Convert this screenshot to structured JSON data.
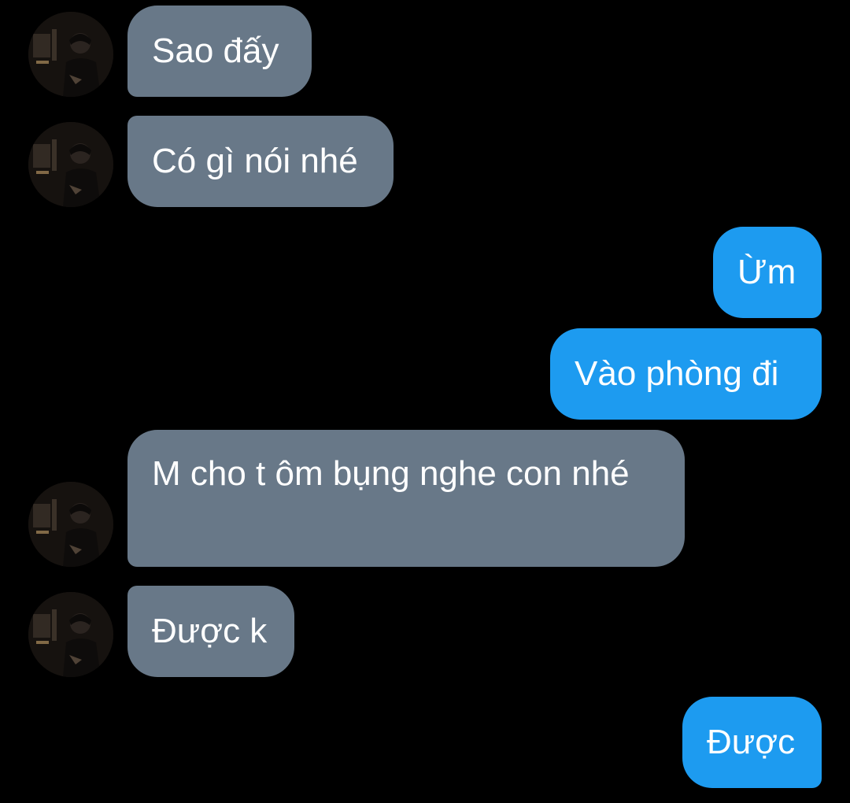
{
  "colors": {
    "background": "#000000",
    "incoming_bubble": "#687888",
    "outgoing_bubble": "#1d9bf0",
    "text": "#ffffff"
  },
  "messages": [
    {
      "direction": "incoming",
      "text": "Sao đấy",
      "avatar": "avatar-photo"
    },
    {
      "direction": "incoming",
      "text": "Có gì nói nhé",
      "avatar": "avatar-photo"
    },
    {
      "direction": "outgoing",
      "text": "Ừm"
    },
    {
      "direction": "outgoing",
      "text": "Vào phòng đi"
    },
    {
      "direction": "incoming",
      "text": "M cho t ôm bụng nghe con nhé",
      "avatar": "avatar-photo"
    },
    {
      "direction": "incoming",
      "text": "Được k",
      "avatar": "avatar-photo"
    },
    {
      "direction": "outgoing",
      "text": "Được"
    }
  ]
}
